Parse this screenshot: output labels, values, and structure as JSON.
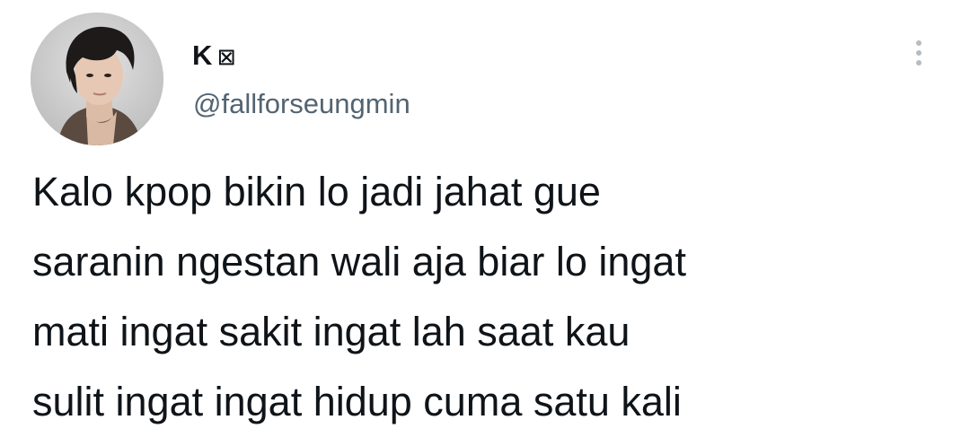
{
  "tweet": {
    "author": {
      "display_name": "K",
      "name_symbol": "☒",
      "handle": "@fallforseungmin",
      "avatar_icon": "profile-photo"
    },
    "more_icon": "vertical-ellipsis-icon",
    "text_lines": [
      "Kalo kpop bikin lo jadi jahat gue",
      "saranin ngestan wali aja biar lo ingat",
      "mati ingat sakit ingat lah saat kau",
      "sulit ingat ingat hidup cuma satu kali"
    ]
  },
  "colors": {
    "primary_text": "#0f1419",
    "secondary_text": "#536471",
    "icon_gray": "#b5bcc2"
  }
}
